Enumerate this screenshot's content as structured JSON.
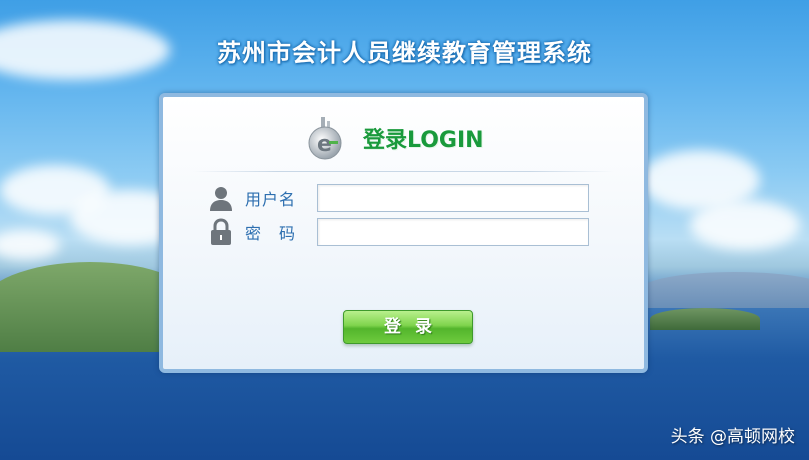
{
  "header": {
    "title": "苏州市会计人员继续教育管理系统"
  },
  "login": {
    "heading": "登录LOGIN",
    "username_label": "用户名",
    "password_label": "密　码",
    "username_value": "",
    "password_value": "",
    "submit_label": "登录"
  },
  "watermark": "头条 @高顿网校",
  "icons": {
    "logo": "e-logo-icon",
    "user": "user-icon",
    "lock": "lock-icon"
  },
  "colors": {
    "title": "#ffffff",
    "heading": "#1a9a3c",
    "label": "#2d6fb0",
    "button": "#6fcb3e"
  }
}
